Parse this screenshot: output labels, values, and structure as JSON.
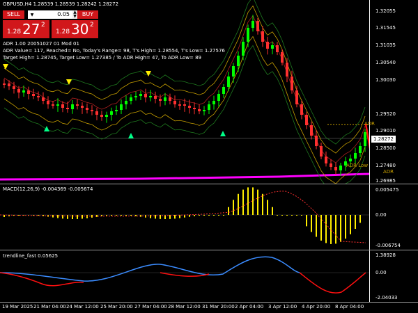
{
  "main": {
    "title": "GBPUSD,H4  1.28539 1.28539 1.28242 1.28272",
    "adr_line1": "ADR 1.00 20051027 01 Mod 01",
    "adr_line2": "ADR Value= 117, Reached= No, Today's Range= 98, T's High= 1.28554, T's Low= 1.27576",
    "adr_line3": "Target High= 1.28745, Target Low= 1.27385 / To ADR High= 47, To ADR Low= 89",
    "current_price": "1.28272",
    "price_ticks": [
      "1.32055",
      "1.31545",
      "1.31035",
      "1.30540",
      "1.30030",
      "1.29520",
      "1.29010",
      "1.28500",
      "1.27480",
      "1.26985"
    ],
    "adr_high_label": "ADR",
    "adr_low_label": "ADR",
    "adr_low_caption": "ADR Low",
    "colors": {
      "bull": "#00ff00",
      "bear": "#ff3030",
      "band": "#c8a000",
      "adr_line": "#ff00ff",
      "sell": "#d1171b"
    }
  },
  "trade_panel": {
    "sell_label": "SELL",
    "buy_label": "BUY",
    "lot_value": "0.05",
    "sell_small": "1.28",
    "sell_big": "27",
    "sell_sup": "2",
    "buy_small": "1.28",
    "buy_big": "30",
    "buy_sup": "2",
    "down_icon": "▼",
    "up_icon": "▲"
  },
  "macd": {
    "label": "MACD(12,26,9) -0.004369 -0.005674",
    "ticks": [
      "0.005475",
      "0.00",
      "-0.006754"
    ]
  },
  "trendline": {
    "label": "trendline_fast 0.05625",
    "ticks": [
      "1.38928",
      "0.00",
      "-2.04033"
    ]
  },
  "x_axis": [
    "19 Mar 2025",
    "21 Mar 04:00",
    "24 Mar 12:00",
    "25 Mar 20:00",
    "27 Mar 04:00",
    "28 Mar 12:00",
    "31 Mar 20:00",
    "2 Apr 04:00",
    "3 Apr 12:00",
    "4 Apr 20:00",
    "8 Apr 04:00"
  ]
}
